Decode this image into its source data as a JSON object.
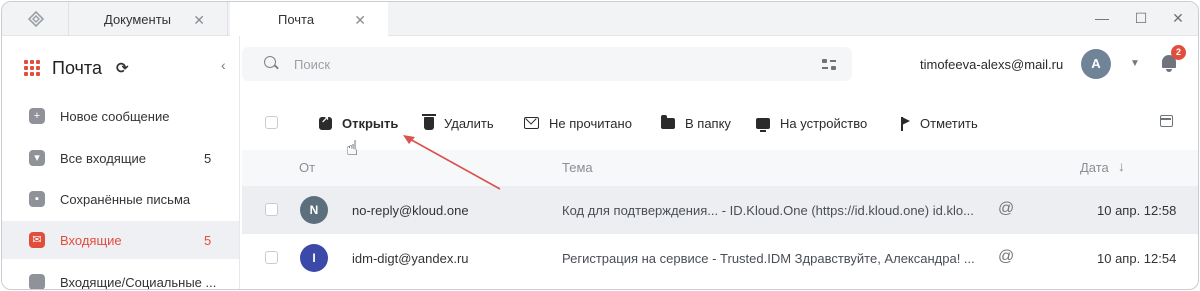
{
  "tabs": [
    {
      "label": "Документы"
    },
    {
      "label": "Почта"
    }
  ],
  "tab_close_glyph": "✕",
  "window_controls": {
    "minimize": "—",
    "maximize": "☐",
    "close": "✕"
  },
  "sidebar": {
    "title": "Почта",
    "items": [
      {
        "label": "Новое сообщение",
        "count": "",
        "icon": "plus-icon"
      },
      {
        "label": "Все входящие",
        "count": "5",
        "icon": "inbox-icon"
      },
      {
        "label": "Сохранённые письма",
        "count": "",
        "icon": "save-icon"
      },
      {
        "label": "Входящие",
        "count": "5",
        "icon": "mail-icon",
        "active": true
      },
      {
        "label": "Входящие/Социальные ...",
        "count": "",
        "icon": "folder-icon"
      }
    ]
  },
  "search": {
    "placeholder": "Поиск"
  },
  "account": {
    "email": "timofeeva-alexs@mail.ru",
    "avatar_letter": "A",
    "notifications": "2"
  },
  "toolbar": {
    "open": "Открыть",
    "delete": "Удалить",
    "unread": "Не прочитано",
    "to_folder": "В папку",
    "to_device": "На устройство",
    "flag": "Отметить"
  },
  "columns": {
    "from": "От",
    "subject": "Тема",
    "date": "Дата"
  },
  "messages": [
    {
      "avatar_letter": "N",
      "avatar_color": "#5b6f7d",
      "sender": "no-reply@kloud.one",
      "subject": "Код для подтверждения...  -  ID.Kloud.One (https://id.kloud.one) id.klo...",
      "date": "10 апр. 12:58"
    },
    {
      "avatar_letter": "I",
      "avatar_color": "#3b49a8",
      "sender": "idm-digt@yandex.ru",
      "subject": "Регистрация на сервисе -  Trusted.IDM Здравствуйте, Александра! ...",
      "date": "10 апр. 12:54"
    }
  ],
  "colors": {
    "accent": "#e24e3c",
    "hover_row": "#eceef1",
    "annotation": "#d9534f"
  }
}
